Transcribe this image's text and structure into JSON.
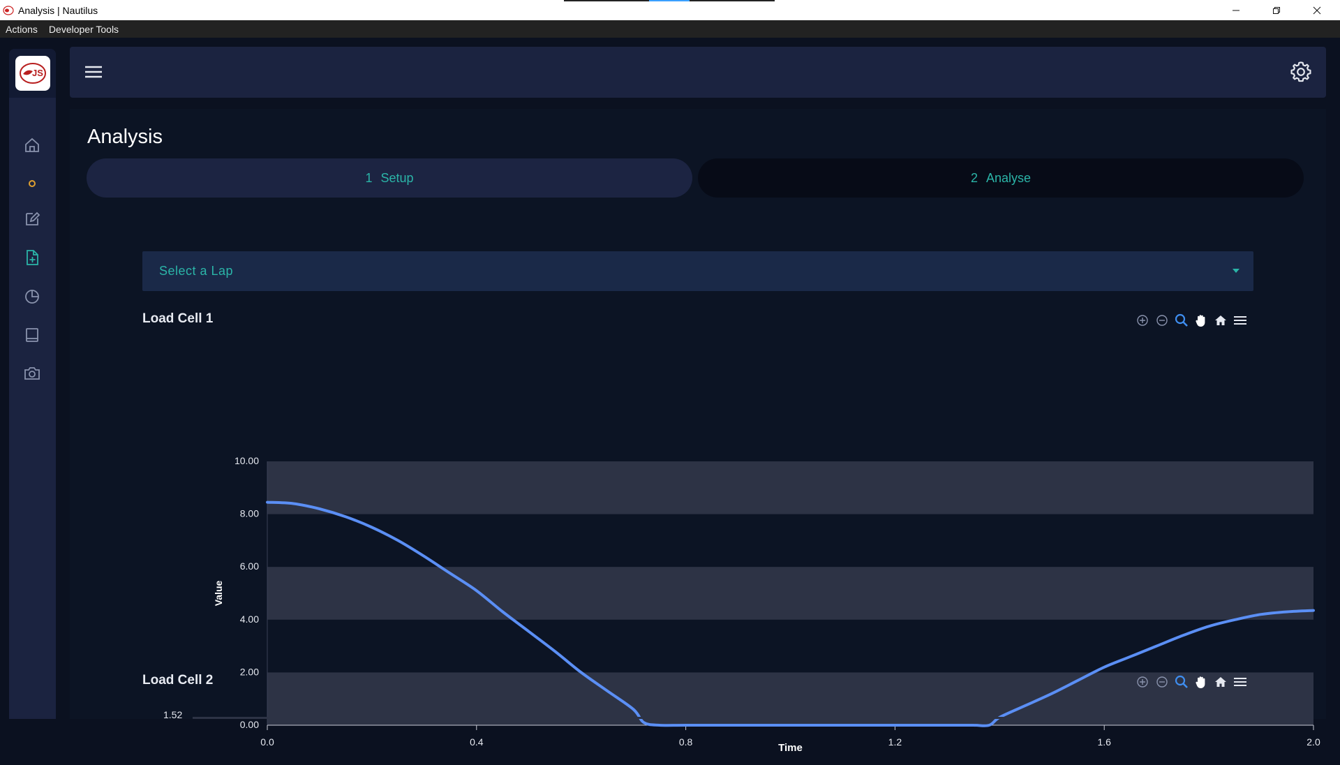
{
  "window": {
    "title": "Analysis | Nautilus"
  },
  "menu": {
    "items": [
      "Actions",
      "Developer Tools"
    ]
  },
  "page": {
    "title": "Analysis"
  },
  "steps": [
    {
      "number": "1",
      "label": "Setup"
    },
    {
      "number": "2",
      "label": "Analyse"
    }
  ],
  "lap_select": {
    "placeholder": "Select a Lap"
  },
  "nav_icons": [
    "home-icon",
    "dot-icon",
    "edit-icon",
    "file-add-icon",
    "pie-chart-icon",
    "book-icon",
    "camera-icon"
  ],
  "colors": {
    "accent": "#2bb5a8",
    "line": "#5b8ff5",
    "nav_bg": "#1b2340",
    "main_bg": "#0c1424",
    "active_nav": "#2bb5a8",
    "dot": "#e0a030"
  },
  "charts": [
    {
      "title": "Load Cell 1"
    },
    {
      "title": "Load Cell 2",
      "first_tick": "1.52"
    }
  ],
  "chart_data": [
    {
      "type": "line",
      "title": "Load Cell 1",
      "xlabel": "Time",
      "ylabel": "Value",
      "xlim": [
        0.0,
        2.0
      ],
      "ylim": [
        0.0,
        10.0
      ],
      "x_ticks": [
        "0.0",
        "0.4",
        "0.8",
        "1.2",
        "1.6",
        "2.0"
      ],
      "y_ticks": [
        "0.00",
        "2.00",
        "4.00",
        "6.00",
        "8.00",
        "10.00"
      ],
      "series": [
        {
          "x": [
            0.0,
            0.05,
            0.1,
            0.15,
            0.2,
            0.25,
            0.3,
            0.35,
            0.4,
            0.45,
            0.5,
            0.55,
            0.6,
            0.65,
            0.7,
            0.72,
            0.75,
            0.8,
            0.9,
            1.0,
            1.1,
            1.2,
            1.3,
            1.35,
            1.38,
            1.4,
            1.45,
            1.5,
            1.55,
            1.6,
            1.65,
            1.7,
            1.75,
            1.8,
            1.85,
            1.9,
            1.95,
            2.0
          ],
          "y": [
            8.45,
            8.4,
            8.2,
            7.9,
            7.5,
            7.0,
            6.4,
            5.75,
            5.1,
            4.3,
            3.55,
            2.8,
            2.0,
            1.3,
            0.6,
            0.1,
            0.0,
            0.0,
            0.0,
            0.0,
            0.0,
            0.0,
            0.0,
            0.0,
            0.0,
            0.3,
            0.75,
            1.2,
            1.7,
            2.2,
            2.6,
            3.0,
            3.4,
            3.75,
            4.0,
            4.2,
            4.3,
            4.35
          ]
        }
      ],
      "grid": "alternating bands"
    }
  ]
}
